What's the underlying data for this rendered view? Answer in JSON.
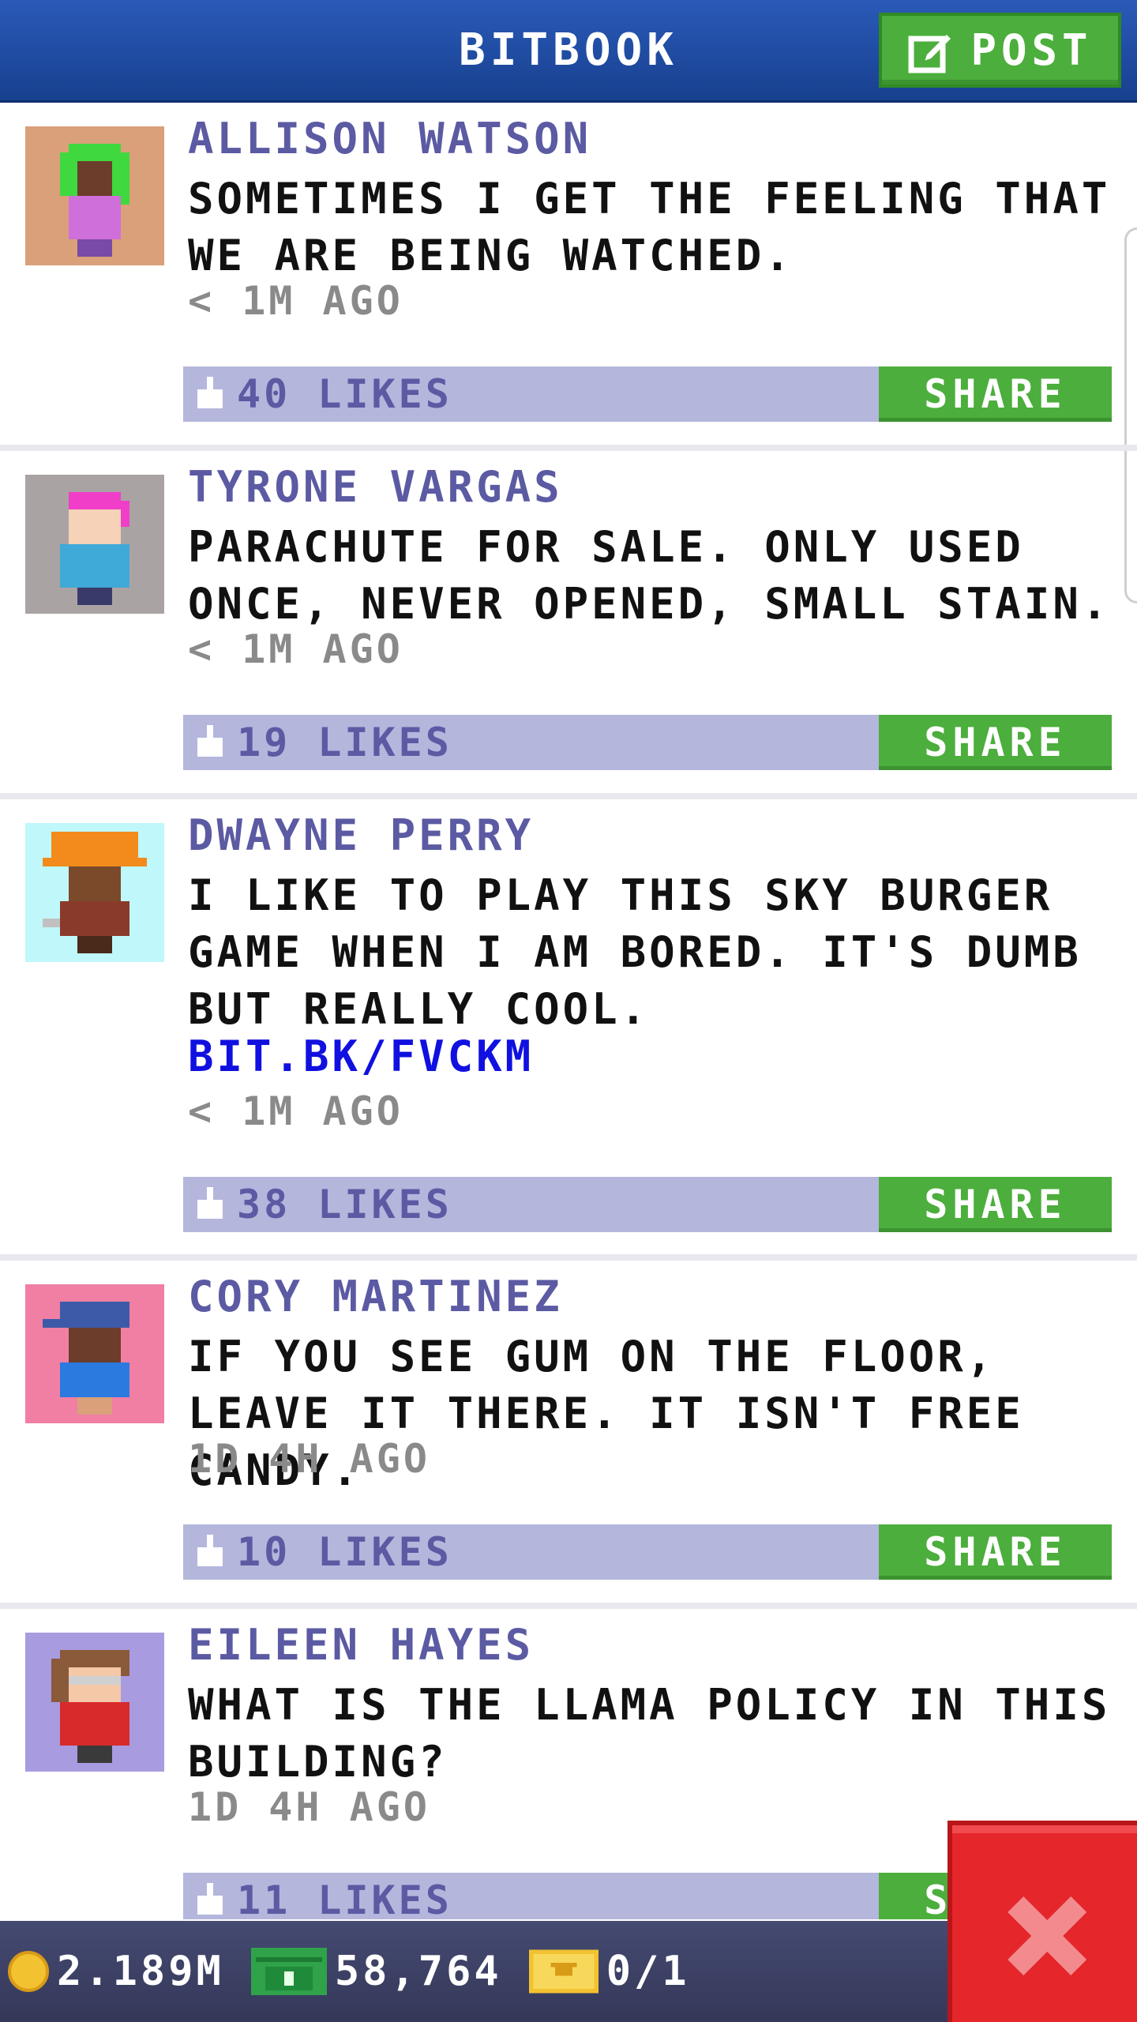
{
  "header": {
    "title": "BITBOOK",
    "post_label": "POST"
  },
  "posts": [
    {
      "author": "ALLISON WATSON",
      "message": "SOMETIMES I GET THE FEELING THAT WE ARE BEING WATCHED.",
      "link": "",
      "time": "< 1M AGO",
      "likes": "40 LIKES",
      "share": "SHARE",
      "avatar_bg": "#d9a07a"
    },
    {
      "author": "TYRONE VARGAS",
      "message": "PARACHUTE FOR SALE. ONLY USED ONCE, NEVER OPENED, SMALL STAIN.",
      "link": "",
      "time": "< 1M AGO",
      "likes": "19 LIKES",
      "share": "SHARE",
      "avatar_bg": "#aaa3a3"
    },
    {
      "author": "DWAYNE PERRY",
      "message": "I LIKE TO PLAY THIS SKY BURGER GAME WHEN I AM BORED. IT'S DUMB BUT REALLY COOL.",
      "link": "BIT.BK/FVCKM",
      "time": "< 1M AGO",
      "likes": "38 LIKES",
      "share": "SHARE",
      "avatar_bg": "#bff7fb"
    },
    {
      "author": "CORY MARTINEZ",
      "message": "IF YOU SEE GUM ON THE FLOOR, LEAVE IT THERE. IT ISN'T FREE CANDY.",
      "link": "",
      "time": "1D 4H AGO",
      "likes": "10 LIKES",
      "share": "SHARE",
      "avatar_bg": "#f07fa3"
    },
    {
      "author": "EILEEN HAYES",
      "message": "WHAT IS THE LLAMA POLICY IN THIS BUILDING?",
      "link": "",
      "time": "1D 4H AGO",
      "likes": "11 LIKES",
      "share": "SHARE",
      "avatar_bg": "#a99be0"
    }
  ],
  "footer": {
    "coins": "2.189M",
    "bux": "58,764",
    "tickets": "0/1"
  },
  "colors": {
    "header": "#1f4fa6",
    "share_green": "#4cae3c",
    "like_bar": "#b4b6dc",
    "author": "#5b5aa3",
    "link": "#1010e0",
    "close_red": "#e5262b"
  }
}
